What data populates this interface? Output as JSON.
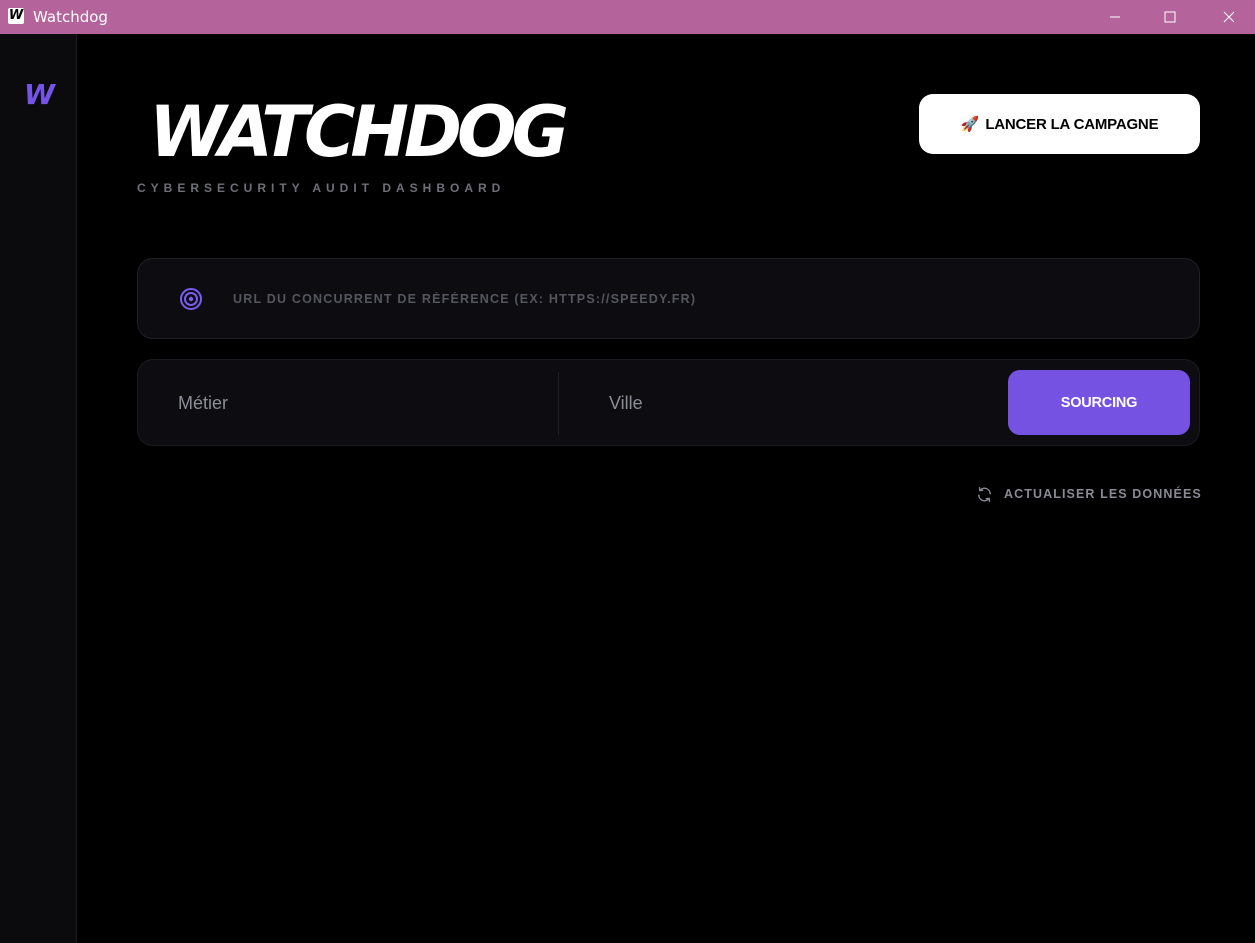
{
  "window": {
    "app_icon_letter": "W",
    "title": "Watchdog",
    "controls": [
      "minimize-icon",
      "maximize-icon",
      "close-icon"
    ]
  },
  "sidebar": {
    "logo": "W"
  },
  "header": {
    "title": "WATCHDOG",
    "subtitle": "CYBERSECURITY AUDIT DASHBOARD",
    "launch_button": {
      "icon": "🚀",
      "label": "LANCER LA CAMPAGNE"
    }
  },
  "url_field": {
    "icon": "target-icon",
    "placeholder": "URL DU CONCURRENT DE RÉFÉRENCE (EX: HTTPS://SPEEDY.FR)",
    "value": ""
  },
  "search": {
    "metier_placeholder": "Métier",
    "ville_placeholder": "Ville",
    "sourcing_label": "SOURCING"
  },
  "refresh": {
    "icon": "refresh-icon",
    "label": "ACTUALISER LES DONNÉES"
  },
  "colors": {
    "titlebar": "#b4649a",
    "accent": "#7652e2",
    "background": "#000000",
    "panel": "#0d0d11"
  }
}
